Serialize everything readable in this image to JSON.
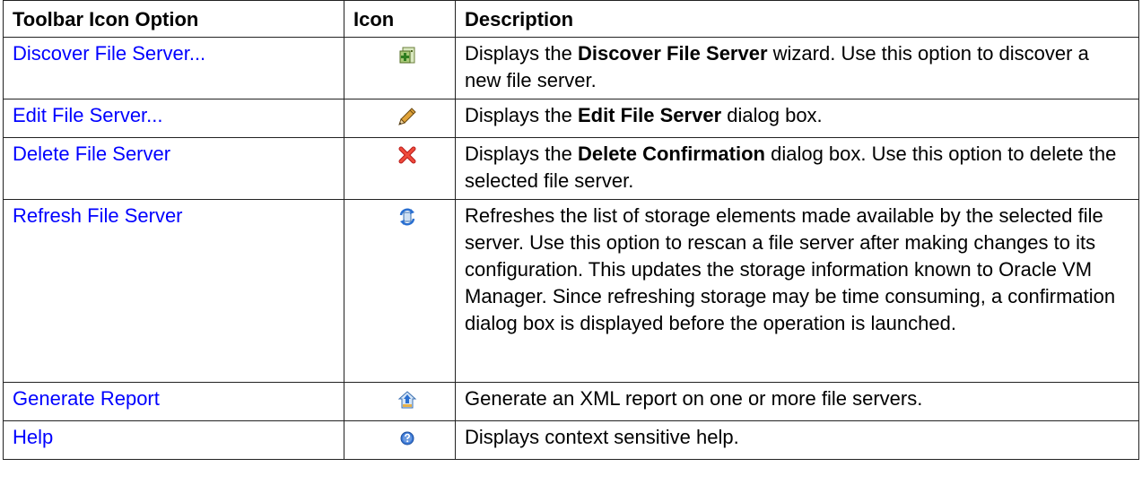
{
  "table": {
    "headers": [
      "Toolbar Icon Option",
      "Icon",
      "Description"
    ],
    "rows": [
      {
        "option": "Discover File Server...",
        "icon": "add-server-icon",
        "desc": [
          "Displays the ",
          "Discover File Server",
          " wizard. Use this option to discover a new file server."
        ]
      },
      {
        "option": "Edit File Server...",
        "icon": "pencil-icon",
        "desc": [
          "Displays the ",
          "Edit File Server",
          " dialog box."
        ]
      },
      {
        "option": "Delete File Server",
        "icon": "delete-x-icon",
        "desc": [
          "Displays the ",
          "Delete Confirmation",
          " dialog box. Use this option to delete the selected file server."
        ]
      },
      {
        "option": "Refresh File Server",
        "icon": "refresh-icon",
        "desc": [
          "",
          "",
          "Refreshes the list of storage elements made available by the selected file server. Use this option to rescan a file server after making changes to its configuration. This updates the storage information known to Oracle VM Manager. Since refreshing storage may be time consuming, a confirmation dialog box is displayed before the operation is launched."
        ]
      },
      {
        "option": "Generate Report",
        "icon": "report-icon",
        "desc": [
          "",
          "",
          "Generate an XML report on one or more file servers."
        ]
      },
      {
        "option": "Help",
        "icon": "help-icon",
        "desc": [
          "",
          "",
          "Displays context sensitive help."
        ]
      }
    ]
  },
  "colors": {
    "link": "#0000ff",
    "border": "#222222"
  }
}
